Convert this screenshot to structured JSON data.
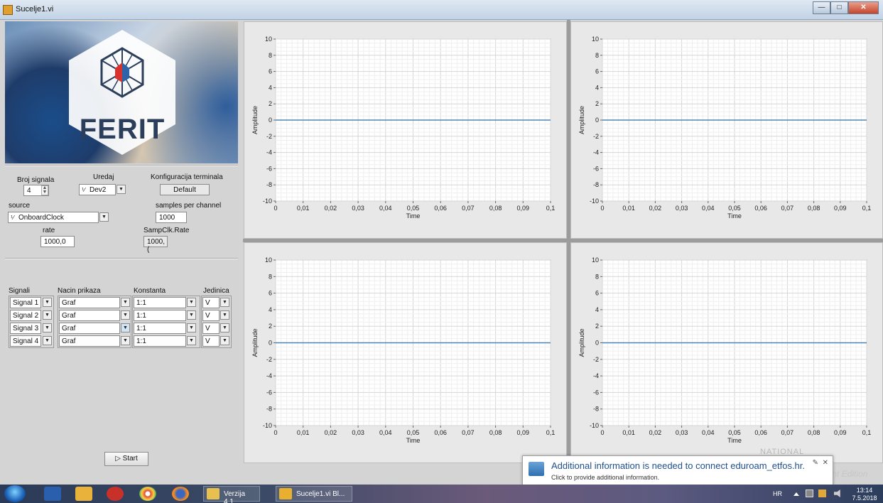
{
  "window": {
    "title": "Sucelje1.vi",
    "buttons": [
      "—",
      "□",
      "✕"
    ]
  },
  "logo": {
    "text": "FERIT"
  },
  "config": {
    "broj_signala_label": "Broj signala",
    "broj_signala_value": "4",
    "uredaj_label": "Uredaj",
    "uredaj_value": "Dev2",
    "konfig_label": "Konfiguracija terminala",
    "konfig_value": "Default",
    "source_label": "source",
    "source_value": "OnboardClock",
    "samples_label": "samples per channel",
    "samples_value": "1000",
    "rate_label": "rate",
    "rate_value": "1000,0",
    "sampclk_label": "SampClk.Rate",
    "sampclk_value": "1000,("
  },
  "signals_table": {
    "headers": [
      "Signali",
      "Nacin prikaza",
      "Konstanta",
      "Jedinica"
    ],
    "rows": [
      {
        "signal": "Signal 1",
        "nacin": "Graf",
        "konst": "1:1",
        "jed": "V"
      },
      {
        "signal": "Signal 2",
        "nacin": "Graf",
        "konst": "1:1",
        "jed": "V"
      },
      {
        "signal": "Signal 3",
        "nacin": "Graf",
        "konst": "1:1",
        "jed": "V"
      },
      {
        "signal": "Signal 4",
        "nacin": "Graf",
        "konst": "1:1",
        "jed": "V"
      }
    ]
  },
  "start_button": "Start",
  "chart_data": [
    {
      "type": "line",
      "xlabel": "Time",
      "ylabel": "Amplitude",
      "xlim": [
        0,
        0.1
      ],
      "ylim": [
        -10,
        10
      ],
      "x_ticks": [
        "0",
        "0,01",
        "0,02",
        "0,03",
        "0,04",
        "0,05",
        "0,06",
        "0,07",
        "0,08",
        "0,09",
        "0,1"
      ],
      "y_ticks": [
        "10",
        "8",
        "6",
        "4",
        "2",
        "0",
        "-2",
        "-4",
        "-6",
        "-8",
        "-10"
      ],
      "series": [
        {
          "x": [
            0,
            0.1
          ],
          "y": [
            0,
            0
          ]
        }
      ],
      "color": "#4a86b8",
      "grid": true
    },
    {
      "type": "line",
      "xlabel": "Time",
      "ylabel": "Amplitude",
      "xlim": [
        0,
        0.1
      ],
      "ylim": [
        -10,
        10
      ],
      "x_ticks": [
        "0",
        "0,01",
        "0,02",
        "0,03",
        "0,04",
        "0,05",
        "0,06",
        "0,07",
        "0,08",
        "0,09",
        "0,1"
      ],
      "y_ticks": [
        "10",
        "8",
        "6",
        "4",
        "2",
        "0",
        "-2",
        "-4",
        "-6",
        "-8",
        "-10"
      ],
      "series": [
        {
          "x": [
            0,
            0.1
          ],
          "y": [
            0,
            0
          ]
        }
      ],
      "color": "#4a86b8",
      "grid": true
    },
    {
      "type": "line",
      "xlabel": "Time",
      "ylabel": "Amplitude",
      "xlim": [
        0,
        0.1
      ],
      "ylim": [
        -10,
        10
      ],
      "x_ticks": [
        "0",
        "0,01",
        "0,02",
        "0,03",
        "0,04",
        "0,05",
        "0,06",
        "0,07",
        "0,08",
        "0,09",
        "0,1"
      ],
      "y_ticks": [
        "10",
        "8",
        "6",
        "4",
        "2",
        "0",
        "-2",
        "-4",
        "-6",
        "-8",
        "-10"
      ],
      "series": [
        {
          "x": [
            0,
            0.1
          ],
          "y": [
            0,
            0
          ]
        }
      ],
      "color": "#4a86b8",
      "grid": true
    },
    {
      "type": "line",
      "xlabel": "Time",
      "ylabel": "Amplitude",
      "xlim": [
        0,
        0.1
      ],
      "ylim": [
        -10,
        10
      ],
      "x_ticks": [
        "0",
        "0,01",
        "0,02",
        "0,03",
        "0,04",
        "0,05",
        "0,06",
        "0,07",
        "0,08",
        "0,09",
        "0,1"
      ],
      "y_ticks": [
        "10",
        "8",
        "6",
        "4",
        "2",
        "0",
        "-2",
        "-4",
        "-6",
        "-8",
        "-10"
      ],
      "series": [
        {
          "x": [
            0,
            0.1
          ],
          "y": [
            0,
            0
          ]
        }
      ],
      "color": "#4a86b8",
      "grid": true
    }
  ],
  "notification": {
    "title": "Additional information is needed to connect eduroam_etfos.hr.",
    "subtitle": "Click to provide additional information."
  },
  "watermark": "Student Edition",
  "ni_logo": "NATIONAL",
  "taskbar": {
    "tasks": [
      "Verzija 4.1",
      "Sucelje1.vi Bl..."
    ],
    "language": "HR",
    "time": "13:14",
    "date": "7.5.2018"
  }
}
